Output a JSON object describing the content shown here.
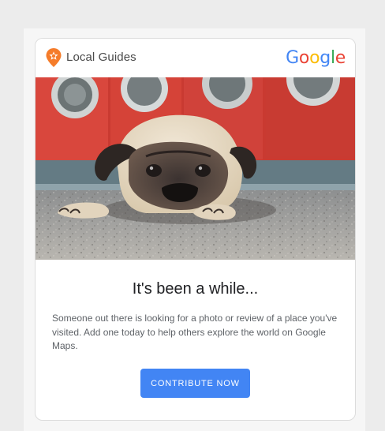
{
  "header": {
    "brand_label": "Local Guides",
    "logo_letters": [
      "G",
      "o",
      "o",
      "g",
      "l",
      "e"
    ],
    "logo_colors": [
      "#4285F4",
      "#EA4335",
      "#FBBC05",
      "#4285F4",
      "#34A853",
      "#EA4335"
    ]
  },
  "hero": {
    "icon": "pug-photo"
  },
  "content": {
    "headline": "It's been a while...",
    "body": "Someone out there is looking for a photo or review of a place you've visited. Add one today to help others explore the world on Google Maps.",
    "cta_label": "CONTRIBUTE NOW"
  },
  "colors": {
    "accent": "#4285F4",
    "brand_orange": "#F57C2A"
  }
}
